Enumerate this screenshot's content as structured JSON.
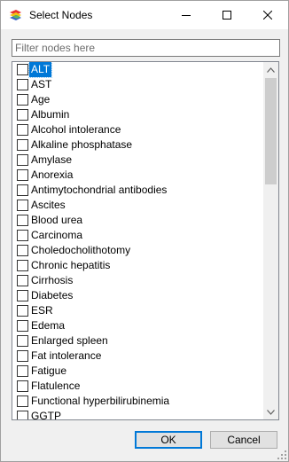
{
  "window": {
    "title": "Select Nodes",
    "icon": "app-logo-icon",
    "controls": [
      "minimize-icon",
      "maximize-icon",
      "close-icon"
    ]
  },
  "filter": {
    "placeholder": "Filter nodes here",
    "value": ""
  },
  "nodes": {
    "selected_index": 0,
    "items": [
      {
        "label": "ALT",
        "checked": false
      },
      {
        "label": "AST",
        "checked": false
      },
      {
        "label": "Age",
        "checked": false
      },
      {
        "label": "Albumin",
        "checked": false
      },
      {
        "label": "Alcohol intolerance",
        "checked": false
      },
      {
        "label": "Alkaline phosphatase",
        "checked": false
      },
      {
        "label": "Amylase",
        "checked": false
      },
      {
        "label": "Anorexia",
        "checked": false
      },
      {
        "label": "Antimytochondrial antibodies",
        "checked": false
      },
      {
        "label": "Ascites",
        "checked": false
      },
      {
        "label": "Blood urea",
        "checked": false
      },
      {
        "label": "Carcinoma",
        "checked": false
      },
      {
        "label": "Choledocholithotomy",
        "checked": false
      },
      {
        "label": "Chronic hepatitis",
        "checked": false
      },
      {
        "label": "Cirrhosis",
        "checked": false
      },
      {
        "label": "Diabetes",
        "checked": false
      },
      {
        "label": "ESR",
        "checked": false
      },
      {
        "label": "Edema",
        "checked": false
      },
      {
        "label": "Enlarged spleen",
        "checked": false
      },
      {
        "label": "Fat intolerance",
        "checked": false
      },
      {
        "label": "Fatigue",
        "checked": false
      },
      {
        "label": "Flatulence",
        "checked": false
      },
      {
        "label": "Functional hyperbilirubinemia",
        "checked": false
      },
      {
        "label": "GGTP",
        "checked": false
      }
    ]
  },
  "buttons": {
    "ok": "OK",
    "cancel": "Cancel"
  },
  "colors": {
    "selection": "#0078d7",
    "default_button_border": "#0078d7"
  }
}
